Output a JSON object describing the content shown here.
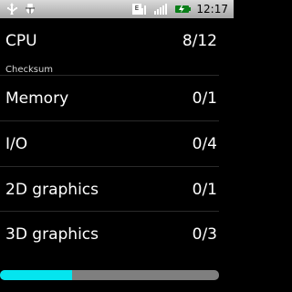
{
  "status_bar": {
    "left_icons": [
      "usb-icon",
      "debug-icon"
    ],
    "right_icons": [
      "edge-network-icon",
      "signal-icon",
      "battery-charging-icon"
    ],
    "time": "12:17"
  },
  "list": {
    "cpu": {
      "label": "CPU",
      "value": "8/12"
    },
    "section_header": "Checksum",
    "memory": {
      "label": "Memory",
      "value": "0/1"
    },
    "io": {
      "label": "I/O",
      "value": "0/4"
    },
    "graphics_2d": {
      "label": "2D graphics",
      "value": "0/1"
    },
    "graphics_3d": {
      "label": "3D graphics",
      "value": "0/3"
    }
  },
  "progress": {
    "fraction": 0.33,
    "colors": {
      "fill": "#05e5ef",
      "track": "#7f7f7f"
    }
  }
}
